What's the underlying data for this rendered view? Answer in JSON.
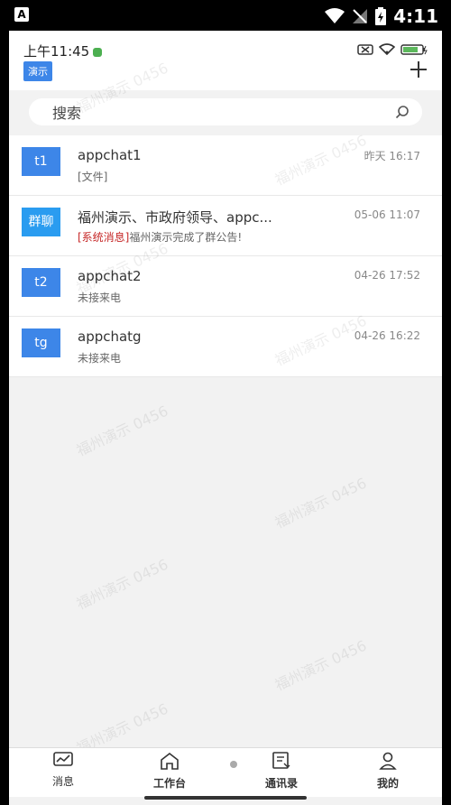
{
  "system_bar": {
    "time": "4:11",
    "app_indicator": "A"
  },
  "inner_status": {
    "time": "上午11:45"
  },
  "header": {
    "badge": "演示"
  },
  "search": {
    "placeholder": "搜索"
  },
  "conversations": [
    {
      "avatar": "t1",
      "name": "appchat1",
      "time": "昨天 16:17",
      "preview_prefix": "",
      "preview": "[文件]"
    },
    {
      "avatar": "群聊",
      "name": "福州演示、市政府领导、appc...",
      "time": "05-06 11:07",
      "preview_prefix": "[系统消息]",
      "preview": "福州演示完成了群公告!"
    },
    {
      "avatar": "t2",
      "name": "appchat2",
      "time": "04-26 17:52",
      "preview_prefix": "",
      "preview": "未接来电"
    },
    {
      "avatar": "tg",
      "name": "appchatg",
      "time": "04-26 16:22",
      "preview_prefix": "",
      "preview": "未接来电"
    }
  ],
  "watermark": "福州演示 0456",
  "tabs": [
    {
      "label": "消息",
      "icon": "chart-icon"
    },
    {
      "label": "工作台",
      "icon": "home-icon"
    },
    {
      "label": "通讯录",
      "icon": "contacts-icon"
    },
    {
      "label": "我的",
      "icon": "user-icon"
    }
  ]
}
